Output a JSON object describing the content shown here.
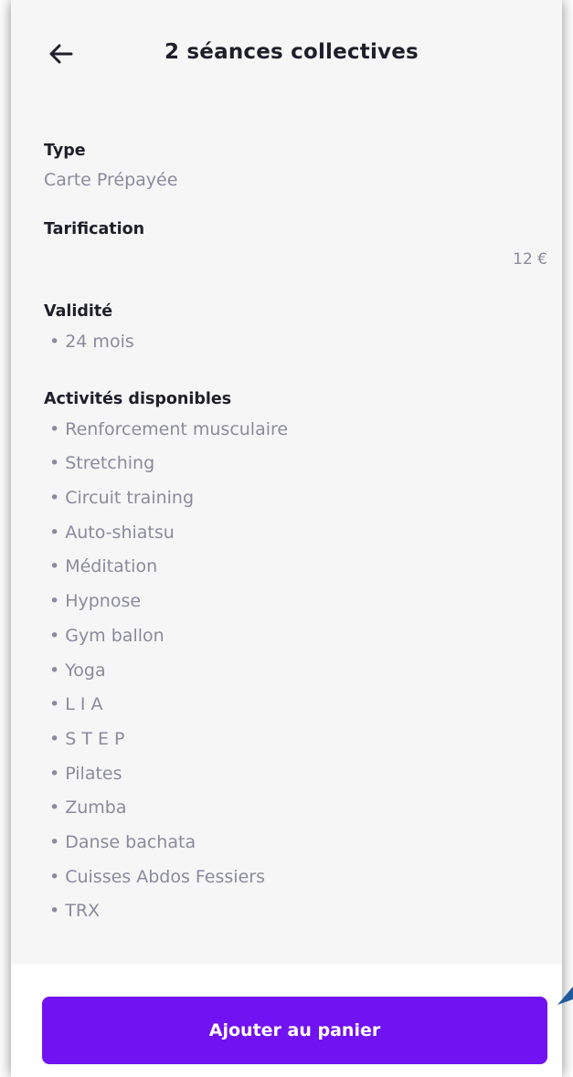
{
  "header": {
    "title": "2 séances collectives",
    "back_icon": "arrow-left-icon"
  },
  "details": {
    "type_label": "Type",
    "type_value": "Carte Prépayée",
    "pricing_label": "Tarification",
    "price": "12 €",
    "validity_label": "Validité",
    "validity_value": "24 mois",
    "activities_label": "Activités disponibles",
    "bullet": "•",
    "activities": [
      "Renforcement musculaire",
      "Stretching",
      "Circuit training",
      "Auto-shiatsu",
      "Méditation",
      "Hypnose",
      "Gym ballon",
      "Yoga",
      "L I A",
      "S T E P",
      "Pilates",
      "Zumba",
      "Danse bachata",
      "Cuisses Abdos Fessiers",
      "TRX"
    ]
  },
  "footer": {
    "add_to_cart_label": "Ajouter au panier"
  },
  "colors": {
    "accent": "#7112f2",
    "background": "#f6f6f6",
    "label_text": "#1f1f2b",
    "muted_text": "#8b8a9e"
  }
}
